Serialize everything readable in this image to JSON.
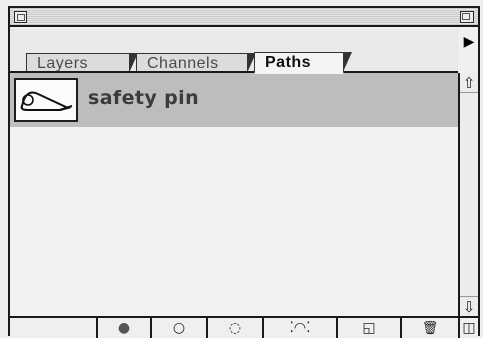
{
  "tabs": [
    {
      "label": "Layers"
    },
    {
      "label": "Channels"
    },
    {
      "label": "Paths"
    }
  ],
  "paths": [
    {
      "name": "safety pin"
    }
  ],
  "icons": {
    "menu": "▶",
    "scroll_up": "⇧",
    "scroll_down": "⇩",
    "fill": "●",
    "stroke": "○",
    "load_selection": "◌",
    "work_path": "⁚◠⁚",
    "new_path": "◱",
    "trash": "🗑",
    "grow": "◫"
  }
}
